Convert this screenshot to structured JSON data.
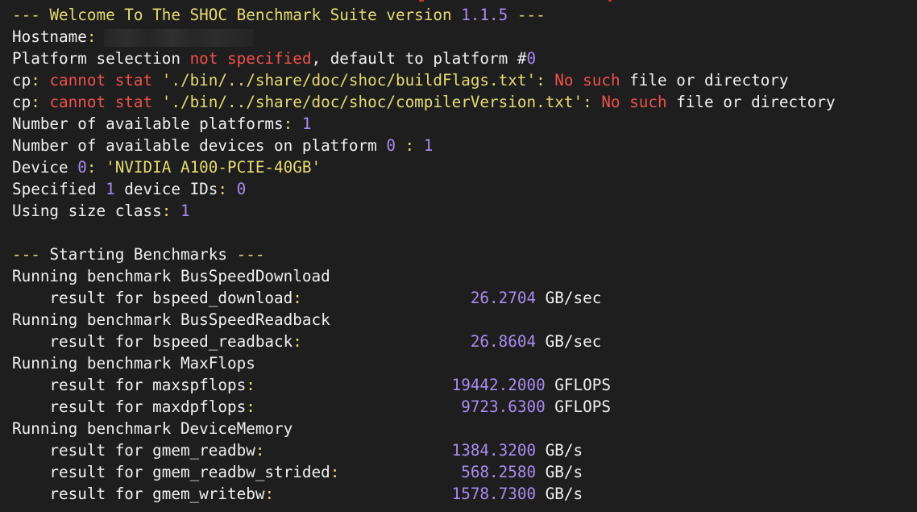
{
  "terminal": {
    "welcome_prefix": "--- ",
    "welcome_text": "Welcome To The SHOC Benchmark Suite version ",
    "version": "1.1.5",
    "welcome_suffix": " ---",
    "hostname_label": "Hostname",
    "colon": ":",
    "platform_pre": "Platform selection ",
    "platform_red": "not specified",
    "platform_post": ", default to platform #",
    "platform_num": "0",
    "cp1_cmd": "cp",
    "cp1_err": "cannot stat",
    "cp1_path": " './bin/../share/doc/shoc/buildFlags.txt'",
    "cp1_colon": ":",
    "cp1_no": " No such",
    "cp1_rest": " file or directory",
    "cp2_cmd": "cp",
    "cp2_err": "cannot stat",
    "cp2_path": " './bin/../share/doc/shoc/compilerVersion.txt'",
    "cp2_colon": ":",
    "cp2_no": " No such",
    "cp2_rest": " file or directory",
    "num_platforms_label": "Number of available platforms",
    "num_platforms": "1",
    "num_devices_label": "Number of available devices on platform ",
    "num_devices_platform": "0",
    "num_devices_sep": " : ",
    "num_devices": "1",
    "device_label": "Device ",
    "device_index": "0",
    "device_name": " 'NVIDIA A100-PCIE-40GB'",
    "specified_pre": "Specified ",
    "specified_count": "1",
    "specified_mid": " device IDs",
    "specified_ids": "0",
    "size_class_label": "Using size class",
    "size_class": "1",
    "start_prefix": "--- ",
    "start_text": "Starting Benchmarks",
    "start_suffix": " ---",
    "run_prefix": "Running benchmark ",
    "result_prefix": "    result for ",
    "benchmarks": [
      {
        "name": "BusSpeedDownload",
        "results": [
          {
            "metric": "bspeed_download",
            "pad": "                  ",
            "value": "26.2704",
            "unit": "GB/sec"
          }
        ]
      },
      {
        "name": "BusSpeedReadback",
        "results": [
          {
            "metric": "bspeed_readback",
            "pad": "                  ",
            "value": "26.8604",
            "unit": "GB/sec"
          }
        ]
      },
      {
        "name": "MaxFlops",
        "results": [
          {
            "metric": "maxspflops",
            "pad": "                     ",
            "value": "19442.2000",
            "unit": "GFLOPS"
          },
          {
            "metric": "maxdpflops",
            "pad": "                      ",
            "value": "9723.6300",
            "unit": "GFLOPS"
          }
        ]
      },
      {
        "name": "DeviceMemory",
        "results": [
          {
            "metric": "gmem_readbw",
            "pad": "                    ",
            "value": "1384.3200",
            "unit": "GB/s"
          },
          {
            "metric": "gmem_readbw_strided",
            "pad": "             ",
            "value": "568.2580",
            "unit": "GB/s"
          },
          {
            "metric": "gmem_writebw",
            "pad": "                   ",
            "value": "1578.7300",
            "unit": "GB/s"
          }
        ]
      }
    ],
    "colors": {
      "background": "#1e1e1e",
      "text": "#f0f0f0",
      "separator": "#e6db74",
      "error": "#f0514c",
      "number": "#a98cf0"
    }
  }
}
